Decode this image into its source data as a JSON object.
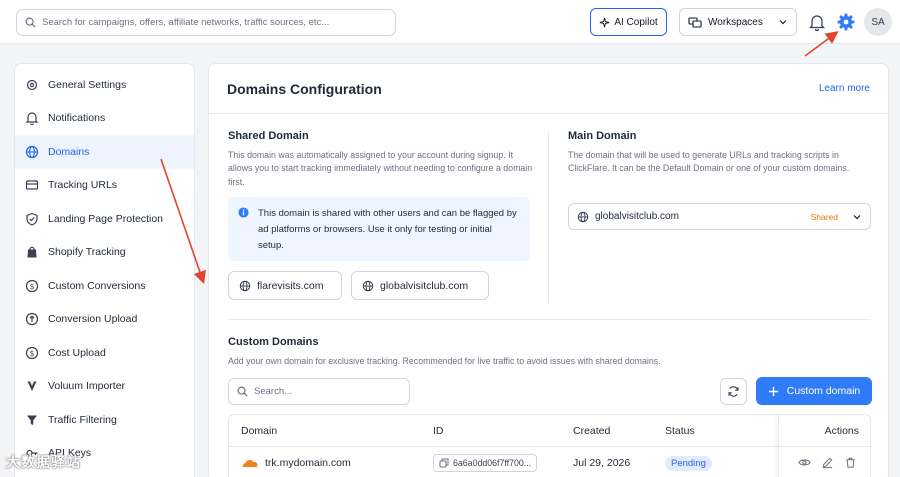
{
  "topbar": {
    "search_placeholder": "Search for campaigns, offers, affiliate networks, traffic sources, etc...",
    "copilot_label": "AI Copilot",
    "workspaces_label": "Workspaces",
    "avatar_initials": "SA"
  },
  "sidebar": {
    "items": [
      {
        "label": "General Settings",
        "icon": "gear-icon"
      },
      {
        "label": "Notifications",
        "icon": "bell-icon"
      },
      {
        "label": "Domains",
        "icon": "globe-icon",
        "active": true
      },
      {
        "label": "Tracking URLs",
        "icon": "card-icon"
      },
      {
        "label": "Landing Page Protection",
        "icon": "shield-icon"
      },
      {
        "label": "Shopify Tracking",
        "icon": "bag-icon"
      },
      {
        "label": "Custom Conversions",
        "icon": "dollar-circle-icon"
      },
      {
        "label": "Conversion Upload",
        "icon": "upload-circle-icon"
      },
      {
        "label": "Cost Upload",
        "icon": "dollar-circle-icon"
      },
      {
        "label": "Voluum Importer",
        "icon": "voluum-icon"
      },
      {
        "label": "Traffic Filtering",
        "icon": "filter-icon"
      },
      {
        "label": "API Keys",
        "icon": "key-icon"
      }
    ]
  },
  "main": {
    "title": "Domains Configuration",
    "learn_more": "Learn more",
    "shared": {
      "title": "Shared Domain",
      "description": "This domain was automatically assigned to your account during signup. It allows you to start tracking immediately without needing to configure a domain first.",
      "info": "This domain is shared with other users and can be flagged by ad platforms or browsers. Use it only for testing or initial setup.",
      "domains": [
        "flarevisits.com",
        "globalvisitclub.com"
      ]
    },
    "main_domain": {
      "title": "Main Domain",
      "description": "The domain that will be used to generate URLs and tracking scripts in ClickFlare. It can be the Default Domain or one of your custom domains.",
      "selected": "globalvisitclub.com",
      "badge": "Shared"
    },
    "custom": {
      "title": "Custom Domains",
      "description": "Add your own domain for exclusive tracking. Recommended for live traffic to avoid issues with shared domains.",
      "search_placeholder": "Search...",
      "add_label": "Custom domain",
      "columns": [
        "Domain",
        "ID",
        "Created",
        "Status",
        "Actions"
      ],
      "rows": [
        {
          "domain": "trk.mydomain.com",
          "id": "6a6a0dd06f7ff700...",
          "created": "Jul 29, 2026",
          "status": "Pending"
        }
      ]
    }
  },
  "colors": {
    "accent": "#2563eb",
    "button": "#2f7cf6",
    "arrow": "#e0452d",
    "shared_badge": "#d97706"
  },
  "watermark": "大数据驿站"
}
